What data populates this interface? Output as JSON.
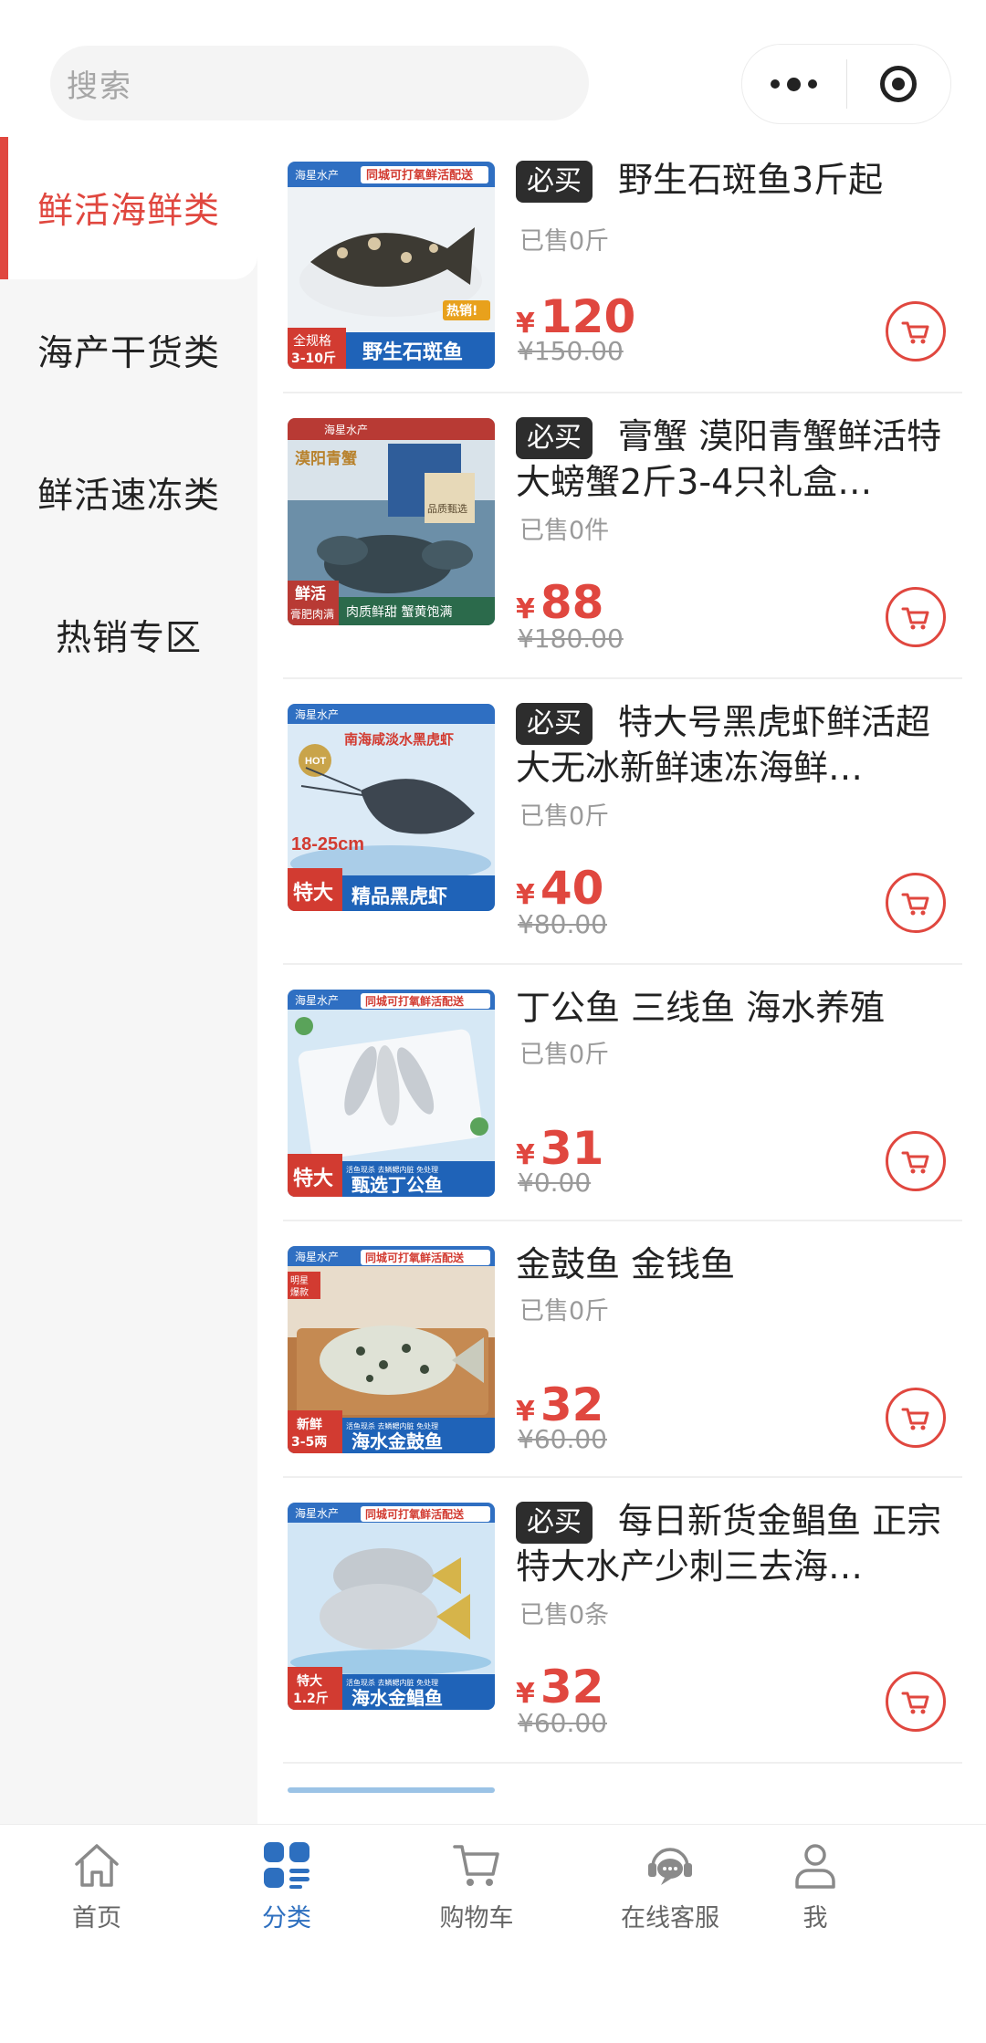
{
  "search": {
    "placeholder": "搜索"
  },
  "capsule": {
    "menu_icon": "more-dots-icon",
    "close_icon": "target-circle-icon"
  },
  "sidebar": {
    "categories": [
      {
        "label": "鲜活海鲜类",
        "active": true
      },
      {
        "label": "海产干货类",
        "active": false
      },
      {
        "label": "鲜活速冻类",
        "active": false
      },
      {
        "label": "热销专区",
        "active": false
      }
    ]
  },
  "products": [
    {
      "badge": "必买",
      "title": "野生石斑鱼3斤起",
      "sold": "已售0斤",
      "currency": "¥",
      "price": "120",
      "original_price": "¥150.00",
      "image": {
        "brand": "海星水产",
        "top_banner": "同城可打氧鲜活配送",
        "corner_tag": "全规格\n3-10斤",
        "bottom_label": "野生石斑鱼",
        "extra": "热销!"
      }
    },
    {
      "badge": "必买",
      "title": "膏蟹 漠阳青蟹鲜活特大螃蟹2斤3-4只礼盒…",
      "sold": "已售0件",
      "currency": "¥",
      "price": "88",
      "original_price": "¥180.00",
      "image": {
        "brand": "海星水产",
        "top_banner": "漠阳青蟹",
        "corner_tag": "鲜活\n膏肥肉满",
        "bottom_label": "肉质鲜甜 蟹黄饱满",
        "extra": "品质甄选"
      }
    },
    {
      "badge": "必买",
      "title": "特大号黑虎虾鲜活超大无冰新鲜速冻海鲜…",
      "sold": "已售0斤",
      "currency": "¥",
      "price": "40",
      "original_price": "¥80.00",
      "image": {
        "brand": "海星水产",
        "top_banner": "南海咸淡水黑虎虾",
        "corner_tag": "特大",
        "bottom_label": "精品黑虎虾",
        "extra": "18-25cm"
      }
    },
    {
      "badge": "",
      "title": "丁公鱼 三线鱼 海水养殖",
      "sold": "已售0斤",
      "currency": "¥",
      "price": "31",
      "original_price": "¥0.00",
      "image": {
        "brand": "海星水产",
        "top_banner": "同城可打氧鲜活配送",
        "corner_tag": "特大",
        "bottom_label": "甄选丁公鱼",
        "extra": "活鱼现杀 去鳞鳃内脏 免处理"
      }
    },
    {
      "badge": "",
      "title": "金鼓鱼 金钱鱼",
      "sold": "已售0斤",
      "currency": "¥",
      "price": "32",
      "original_price": "¥60.00",
      "image": {
        "brand": "海星水产",
        "top_banner": "同城可打氧鲜活配送",
        "corner_tag": "新鲜\n3-5两",
        "bottom_label": "海水金鼓鱼",
        "extra": "活鱼现杀 去鳞鳃内脏 免处理"
      }
    },
    {
      "badge": "必买",
      "title": "每日新货金鲳鱼 正宗特大水产少刺三去海…",
      "sold": "已售0条",
      "currency": "¥",
      "price": "32",
      "original_price": "¥60.00",
      "image": {
        "brand": "海星水产",
        "top_banner": "同城可打氧鲜活配送",
        "corner_tag": "特大\n1.2斤",
        "bottom_label": "海水金鲳鱼",
        "extra": "活鱼现杀 去鳞鳃内脏 免处理"
      }
    }
  ],
  "tabbar": {
    "tabs": [
      {
        "label": "首页",
        "icon": "home-icon",
        "active": false
      },
      {
        "label": "分类",
        "icon": "category-icon",
        "active": true
      },
      {
        "label": "购物车",
        "icon": "cart-icon",
        "active": false
      },
      {
        "label": "在线客服",
        "icon": "customer-service-icon",
        "active": false
      },
      {
        "label": "我",
        "icon": "user-icon",
        "active": false
      }
    ]
  },
  "colors": {
    "accent": "#e0473f",
    "tab_active": "#2d6fbf",
    "badge_bg": "#2d2d2d"
  }
}
